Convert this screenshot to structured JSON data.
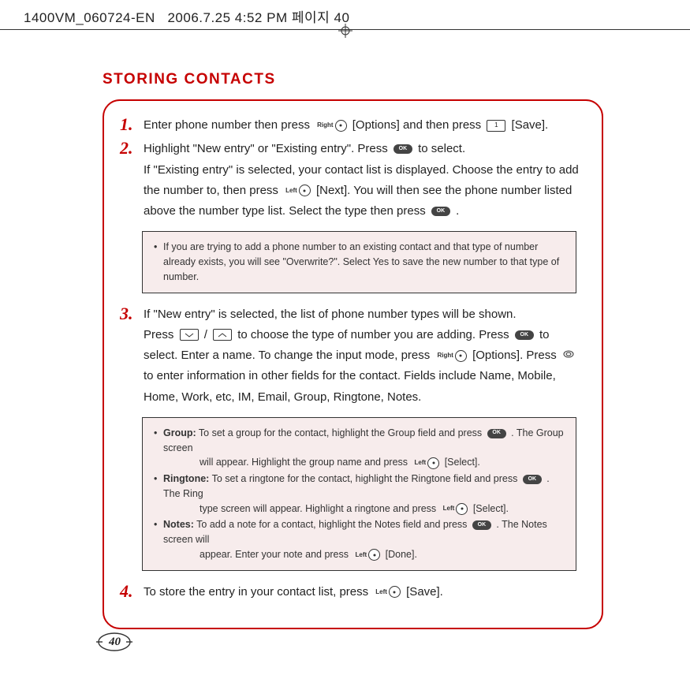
{
  "header": {
    "filecode": "1400VM_060724-EN",
    "timestamp": "2006.7.25 4:52 PM",
    "pagelabel": "페이지",
    "pageno_hdr": "40"
  },
  "title": "STORING CONTACTS",
  "steps": {
    "s1": {
      "num": "1.",
      "a": "Enter phone number then press",
      "b": "[Options] and then press",
      "c": "[Save]."
    },
    "s2": {
      "num": "2.",
      "a": "Highlight \"New entry\" or \"Existing entry\".  Press",
      "b": "to select.",
      "c": "If \"Existing entry\" is selected, your contact list is displayed.  Choose the entry to add the number to, then press",
      "d": "[Next].  You will then see the phone number listed above the number type list.  Select the type then press",
      "e": "."
    },
    "s3": {
      "num": "3.",
      "a": "If \"New entry\" is selected, the list of phone number types will be shown.",
      "b": "Press",
      "c": "/",
      "d": "to choose the type of number you are adding.  Press",
      "e": "to select.  Enter a name.  To change the input mode, press",
      "f": "[Options].  Press",
      "g": "to enter information in other fields for the contact.  Fields include Name, Mobile, Home, Work, etc, IM, Email, Group, Ringtone, Notes."
    },
    "s4": {
      "num": "4.",
      "a": "To store the entry in your contact list, press",
      "b": "[Save]."
    }
  },
  "keys": {
    "right": "Right",
    "left": "Left",
    "ok": "OK"
  },
  "note1": {
    "text": "If you are trying to add a phone number to an existing contact and that type of number already exists, you will see \"Overwrite?\".  Select Yes to save the new number to that type of number."
  },
  "note2": {
    "group_label": "Group:",
    "group_a": "To set a group for the contact, highlight the Group field and press",
    "group_b": ".  The Group screen",
    "group_c": "will appear. Highlight the group name and press",
    "group_d": "[Select].",
    "ring_label": "Ringtone:",
    "ring_a": "To set a ringtone for the contact, highlight the Ringtone field and press",
    "ring_b": ".  The Ring",
    "ring_c": "type screen will appear. Highlight a ringtone and press",
    "ring_d": "[Select].",
    "notes_label": "Notes:",
    "notes_a": "To add a note for a contact, highlight the Notes field and press",
    "notes_b": ".  The Notes screen will",
    "notes_c": "appear.  Enter your note and press",
    "notes_d": "[Done]."
  },
  "page_number": "40"
}
